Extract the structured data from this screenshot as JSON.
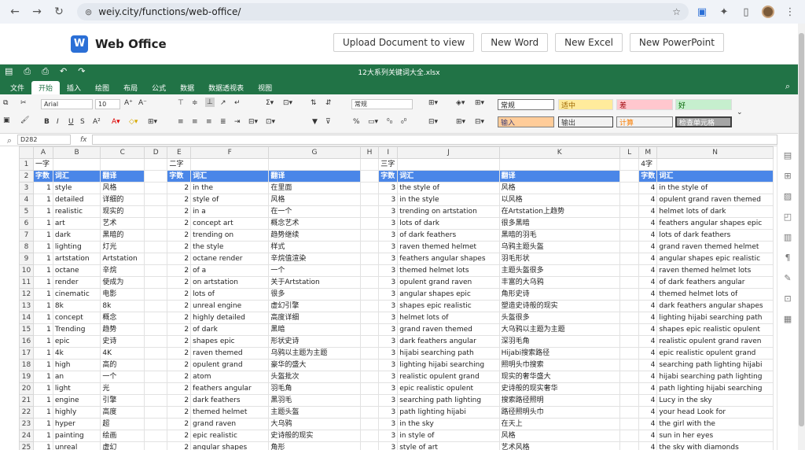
{
  "browser": {
    "url_site": "⊚",
    "url": "weiy.city/functions/web-office/"
  },
  "app": {
    "logo_letter": "W",
    "brand": "Web Office",
    "buttons": [
      "Upload Document to view",
      "New Word",
      "New Excel",
      "New PowerPoint"
    ]
  },
  "sheet": {
    "filename": "12大系列关键词大全.xlsx",
    "menus": [
      "文件",
      "开始",
      "插入",
      "绘图",
      "布局",
      "公式",
      "数据",
      "数据透视表",
      "视图"
    ],
    "active_menu": "开始",
    "font_name": "Arial",
    "font_size": "10",
    "number_format": "常规",
    "styles": {
      "normal": "常规",
      "good_neutral": "适中",
      "bad": "差",
      "good": "好",
      "input": "输入",
      "output": "输出",
      "calc": "计算",
      "check": "检查单元格"
    },
    "name_box": "D282",
    "fx": "fx"
  },
  "grid": {
    "columns": [
      "A",
      "B",
      "C",
      "D",
      "E",
      "F",
      "G",
      "H",
      "I",
      "J",
      "K",
      "L",
      "M",
      "N"
    ],
    "row1": {
      "A": "一字",
      "E": "二字",
      "I": "三字",
      "M": "4字"
    },
    "header": {
      "count": "字数",
      "word": "词汇",
      "trans": "翻译"
    },
    "rows": [
      [
        "1",
        "style",
        "风格",
        "2",
        "in the",
        "在里面",
        "3",
        "the style of",
        "风格",
        "4",
        "in the style of"
      ],
      [
        "1",
        "detailed",
        "详细的",
        "2",
        "style of",
        "风格",
        "3",
        "in the style",
        "以风格",
        "4",
        "opulent grand raven themed"
      ],
      [
        "1",
        "realistic",
        "现实的",
        "2",
        "in a",
        "在一个",
        "3",
        "trending on artstation",
        "在Artstation上趋势",
        "4",
        "helmet lots of dark"
      ],
      [
        "1",
        "art",
        "艺术",
        "2",
        "concept art",
        "概念艺术",
        "3",
        "lots of dark",
        "很多黑暗",
        "4",
        "feathers angular shapes epic"
      ],
      [
        "1",
        "dark",
        "黑暗的",
        "2",
        "trending on",
        "趋势继续",
        "3",
        "of dark feathers",
        "黑暗的羽毛",
        "4",
        "lots of dark feathers"
      ],
      [
        "1",
        "lighting",
        "灯光",
        "2",
        "the style",
        "样式",
        "3",
        "raven themed helmet",
        "乌鸦主题头盔",
        "4",
        "grand raven themed helmet"
      ],
      [
        "1",
        "artstation",
        "Artstation",
        "2",
        "octane render",
        "辛烷值渲染",
        "3",
        "feathers angular shapes",
        "羽毛形状",
        "4",
        "angular shapes epic realistic"
      ],
      [
        "1",
        "octane",
        "辛烷",
        "2",
        "of a",
        "一个",
        "3",
        "themed helmet lots",
        "主题头盔很多",
        "4",
        "raven themed helmet lots"
      ],
      [
        "1",
        "render",
        "使成为",
        "2",
        "on artstation",
        "关于Artstation",
        "3",
        "opulent grand raven",
        "丰富的大乌鸦",
        "4",
        "of dark feathers angular"
      ],
      [
        "1",
        "cinematic",
        "电影",
        "2",
        "lots of",
        "很多",
        "3",
        "angular shapes epic",
        "角形史诗",
        "4",
        "themed helmet lots of"
      ],
      [
        "1",
        "8k",
        "8k",
        "2",
        "unreal engine",
        "虚幻引擎",
        "3",
        "shapes epic realistic",
        "塑造史诗般的现实",
        "4",
        "dark feathers angular shapes"
      ],
      [
        "1",
        "concept",
        "概念",
        "2",
        "highly detailed",
        "高度详细",
        "3",
        "helmet lots of",
        "头盔很多",
        "4",
        "lighting hijabi searching path"
      ],
      [
        "1",
        "Trending",
        "趋势",
        "2",
        "of dark",
        "黑暗",
        "3",
        "grand raven themed",
        "大乌鸦以主题为主题",
        "4",
        "shapes epic realistic opulent"
      ],
      [
        "1",
        "epic",
        "史诗",
        "2",
        "shapes epic",
        "形状史诗",
        "3",
        "dark feathers angular",
        "深羽毛角",
        "4",
        "realistic opulent grand raven"
      ],
      [
        "1",
        "4k",
        "4K",
        "2",
        "raven themed",
        "乌鸦以主题为主题",
        "3",
        "hijabi searching path",
        "Hijabi搜索路径",
        "4",
        "epic realistic opulent grand"
      ],
      [
        "1",
        "high",
        "高的",
        "2",
        "opulent grand",
        "豪华的盛大",
        "3",
        "lighting hijabi searching",
        "照明头巾搜索",
        "4",
        "searching path lighting hijabi"
      ],
      [
        "1",
        "an",
        "一个",
        "2",
        "atom",
        "头盔批次",
        "3",
        "realistic opulent grand",
        "现实的奢华盛大",
        "4",
        "hijabi searching path lighting"
      ],
      [
        "1",
        "light",
        "光",
        "2",
        "feathers angular",
        "羽毛角",
        "3",
        "epic realistic opulent",
        "史诗般的现实奢华",
        "4",
        "path lighting hijabi searching"
      ],
      [
        "1",
        "engine",
        "引擎",
        "2",
        "dark feathers",
        "黑羽毛",
        "3",
        "searching path lighting",
        "搜索路径照明",
        "4",
        "Lucy in the sky"
      ],
      [
        "1",
        "highly",
        "高度",
        "2",
        "themed helmet",
        "主题头盔",
        "3",
        "path lighting hijabi",
        "路径照明头巾",
        "4",
        "your head Look for"
      ],
      [
        "1",
        "hyper",
        "超",
        "2",
        "grand raven",
        "大乌鸦",
        "3",
        "in the sky",
        "在天上",
        "4",
        "the girl with the"
      ],
      [
        "1",
        "painting",
        "绘画",
        "2",
        "epic realistic",
        "史诗般的现实",
        "3",
        "in style of",
        "风格",
        "4",
        "sun in her eyes"
      ],
      [
        "1",
        "unreal",
        "虚幻",
        "2",
        "angular shapes",
        "角形",
        "3",
        "style of art",
        "艺术风格",
        "4",
        "the sky with diamonds"
      ]
    ]
  }
}
